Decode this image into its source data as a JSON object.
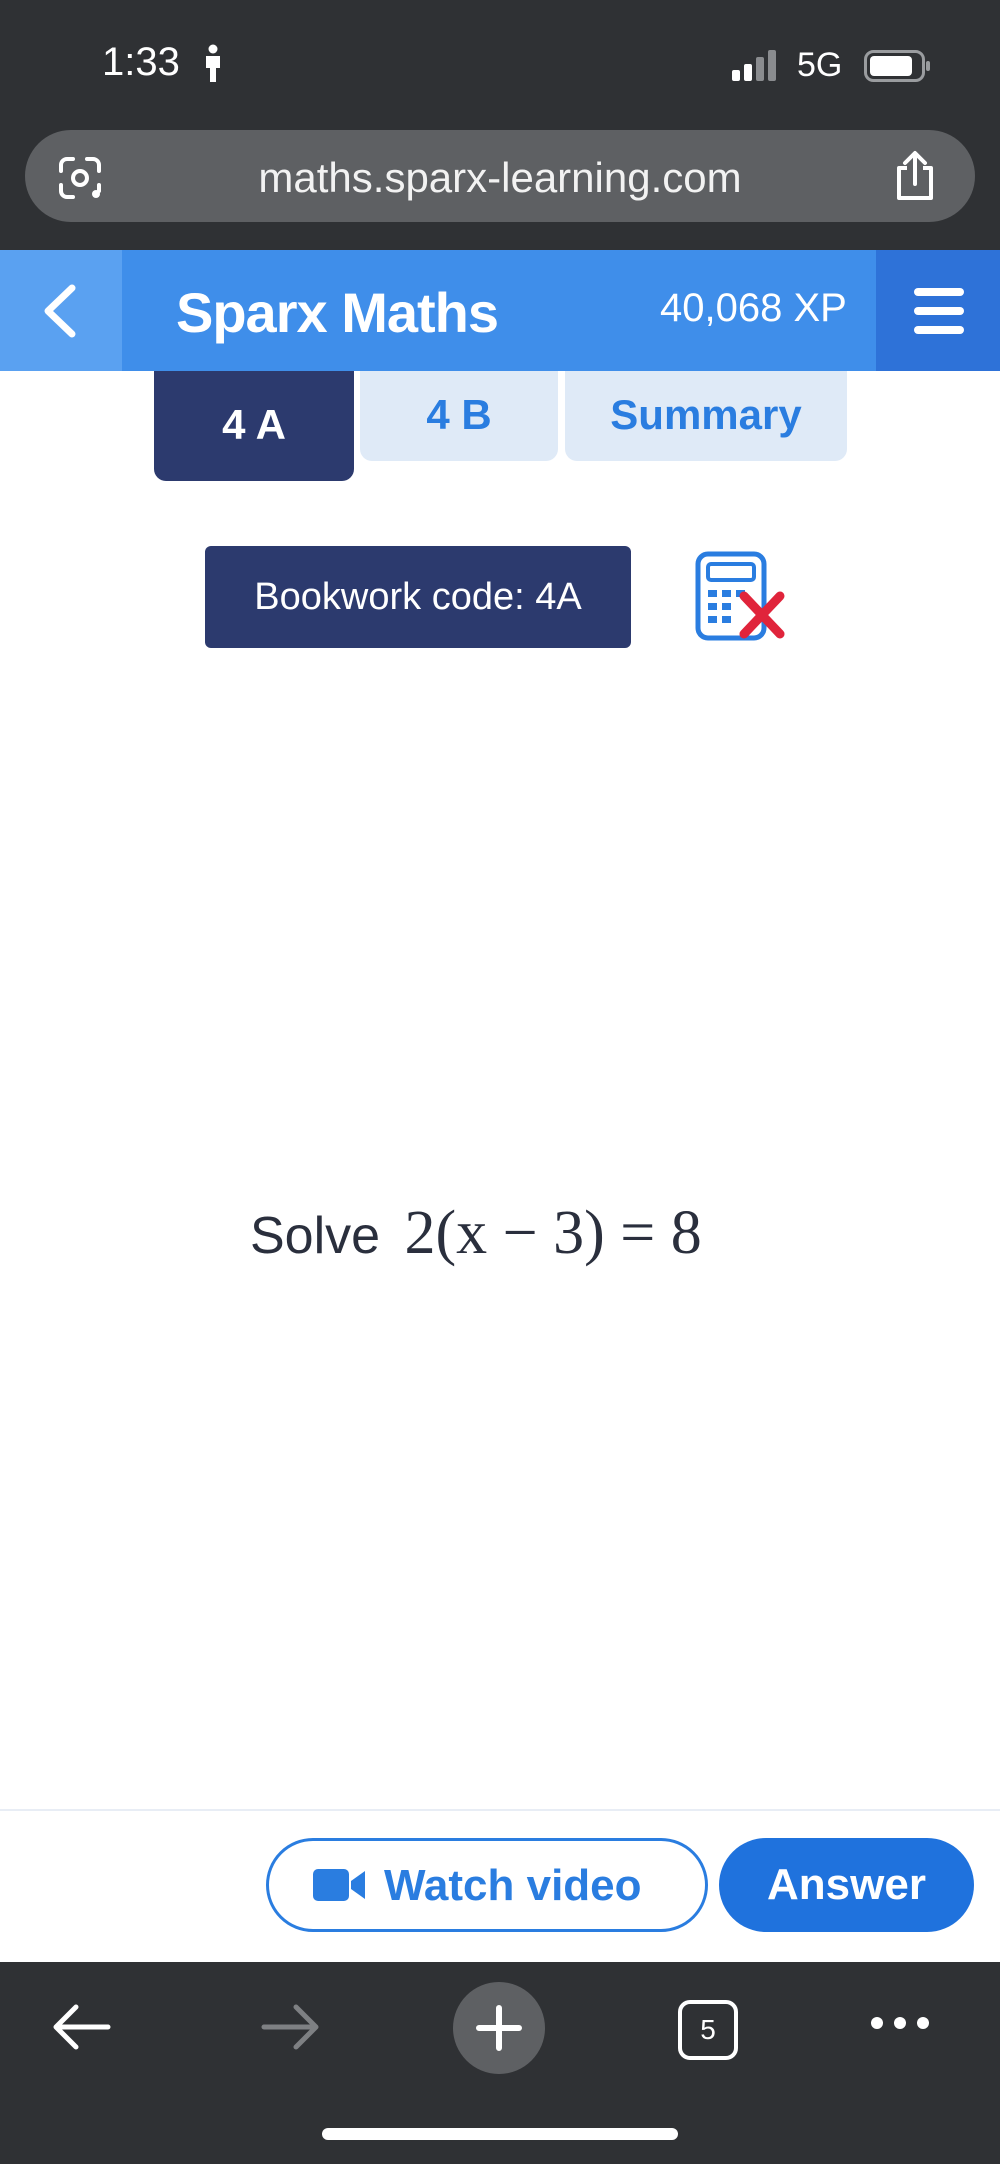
{
  "status_bar": {
    "time": "1:33",
    "network": "5G",
    "icons": [
      "person-walking-icon",
      "signal-icon",
      "battery-icon"
    ]
  },
  "browser": {
    "url": "maths.sparx-learning.com",
    "icons": [
      "google-lens-icon",
      "share-icon"
    ],
    "open_tabs_count": "5"
  },
  "header": {
    "title": "Sparx Maths",
    "xp": "40,068 XP",
    "colors": {
      "bar": "#3f8eea",
      "back": "#5aa1f1",
      "menu": "#2e72d8"
    }
  },
  "tabs": [
    {
      "label": "4 A",
      "active": true
    },
    {
      "label": "4 B",
      "active": false
    },
    {
      "label": "Summary",
      "active": false
    }
  ],
  "bookwork": {
    "label": "Bookwork code: 4A",
    "calculator_allowed": false
  },
  "question": {
    "prefix": "Solve",
    "math": "2(x − 3) = 8"
  },
  "actions": {
    "watch_video": "Watch video",
    "answer": "Answer"
  },
  "colors": {
    "navy": "#2c3a6e",
    "accent_blue": "#2a7de0",
    "chrome": "#2f3134"
  }
}
